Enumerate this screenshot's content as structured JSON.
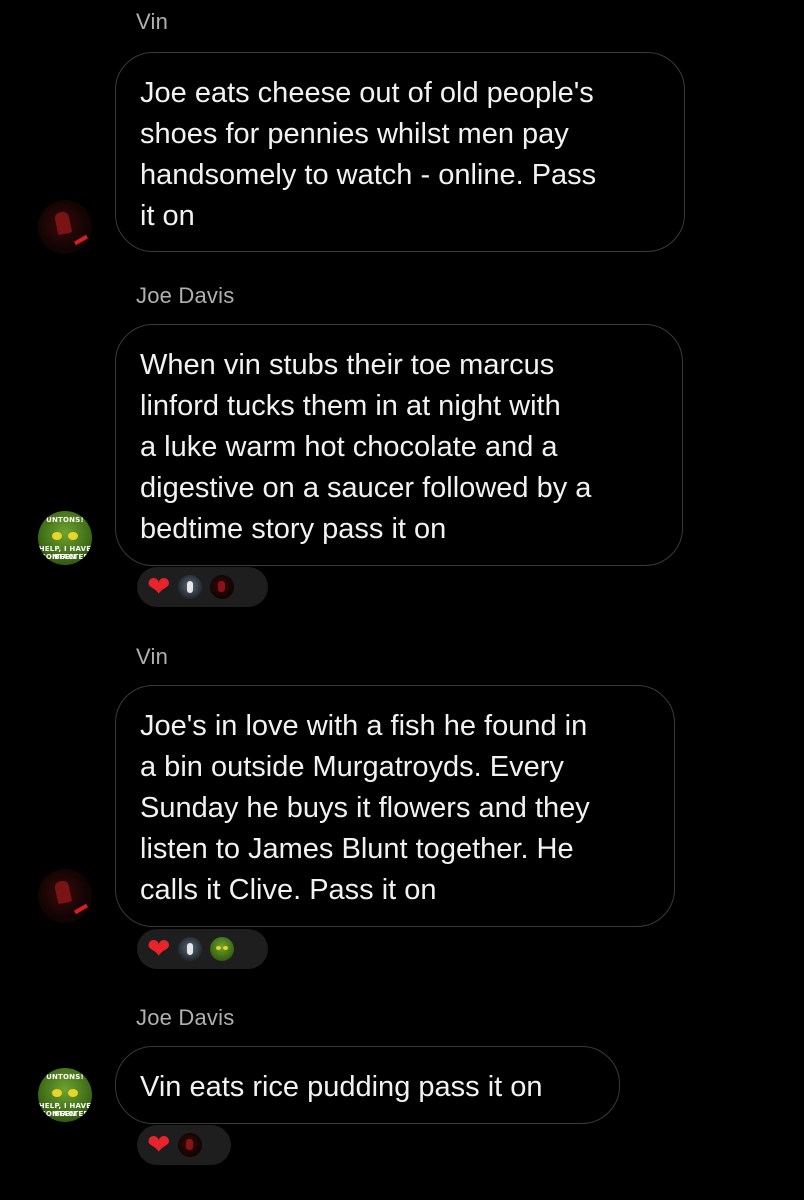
{
  "colors": {
    "background": "#000000",
    "bubble_border": "#3a3a3a",
    "sender_text": "#b0b0b0",
    "message_text": "#f2f2f2",
    "reaction_pill": "#1e1e1e",
    "heart": "#e8232c"
  },
  "messages": [
    {
      "sender": "Vin",
      "avatar_icon": "dark-red-figure-avatar-icon",
      "lines": [
        "Joe eats cheese out of old people's",
        "shoes for pennies whilst men pay",
        "handsomely to watch - online. Pass",
        "it on"
      ],
      "reactions": []
    },
    {
      "sender": "Joe Davis",
      "avatar_icon": "green-alien-meme-avatar-icon",
      "avatar_text": [
        "UNTONS!",
        "HELP, I HAVE BEEN",
        "CONTACTED"
      ],
      "lines": [
        "When vin stubs their toe marcus",
        "linford tucks them in at night with",
        "a luke warm hot chocolate and a",
        "digestive on a saucer followed by a",
        "bedtime story pass it on"
      ],
      "reactions": [
        {
          "icon": "red-heart-icon",
          "glyph": "❤"
        },
        {
          "icon": "reactor-avatar-gray-icon"
        },
        {
          "icon": "reactor-avatar-vin-icon"
        }
      ]
    },
    {
      "sender": "Vin",
      "avatar_icon": "dark-red-figure-avatar-icon",
      "lines": [
        "Joe's in love with a fish he found in",
        "a bin outside Murgatroyds. Every",
        "Sunday he buys it flowers and they",
        "listen to James Blunt together. He",
        "calls it Clive. Pass it on"
      ],
      "reactions": [
        {
          "icon": "red-heart-icon",
          "glyph": "❤"
        },
        {
          "icon": "reactor-avatar-gray-icon"
        },
        {
          "icon": "reactor-avatar-joe-icon"
        }
      ]
    },
    {
      "sender": "Joe Davis",
      "avatar_icon": "green-alien-meme-avatar-icon",
      "avatar_text": [
        "UNTONS!",
        "HELP, I HAVE BEEN",
        "CONTACTED"
      ],
      "lines": [
        "Vin eats rice pudding pass it on"
      ],
      "reactions": [
        {
          "icon": "red-heart-icon",
          "glyph": "❤"
        },
        {
          "icon": "reactor-avatar-vin-icon"
        }
      ]
    }
  ]
}
